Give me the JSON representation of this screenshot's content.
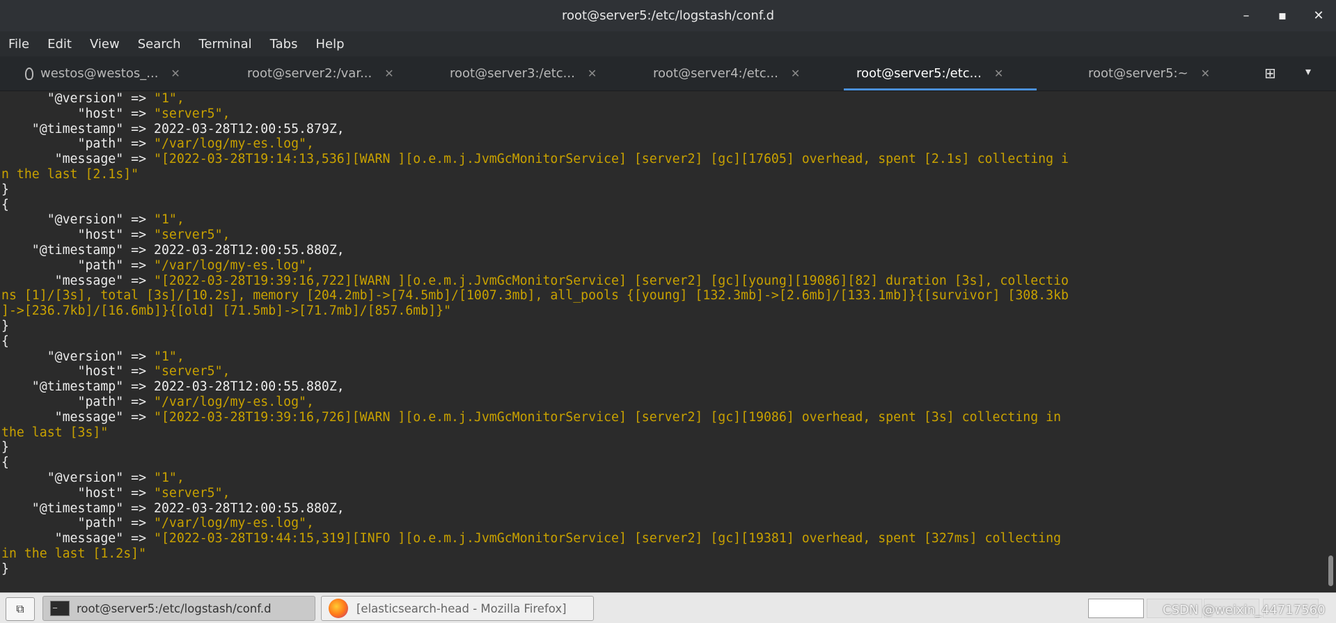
{
  "window": {
    "title": "root@server5:/etc/logstash/conf.d",
    "minimize": "–",
    "maximize": "▪",
    "close": "✕"
  },
  "menu": [
    "File",
    "Edit",
    "View",
    "Search",
    "Terminal",
    "Tabs",
    "Help"
  ],
  "tabs": [
    {
      "label": "westos@westos_...",
      "close": "✕"
    },
    {
      "label": "root@server2:/var...",
      "close": "✕"
    },
    {
      "label": "root@server3:/etc...",
      "close": "✕"
    },
    {
      "label": "root@server4:/etc...",
      "close": "✕"
    },
    {
      "label": "root@server5:/etc...",
      "close": "✕"
    },
    {
      "label": "root@server5:~",
      "close": "✕"
    }
  ],
  "tabbar": {
    "new_tab_icon": "⊞",
    "menu_icon": "▾"
  },
  "terminal": {
    "lines": [
      {
        "k": "      \"@version\" => ",
        "v": "\"1\","
      },
      {
        "k": "          \"host\" => ",
        "v": "\"server5\","
      },
      {
        "k": "    \"@timestamp\" => 2022-03-28T12:00:55.879Z,",
        "v": ""
      },
      {
        "k": "          \"path\" => ",
        "v": "\"/var/log/my-es.log\","
      },
      {
        "k": "       \"message\" => ",
        "v": "\"[2022-03-28T19:14:13,536][WARN ][o.e.m.j.JvmGcMonitorService] [server2] [gc][17605] overhead, spent [2.1s] collecting i"
      },
      {
        "k": "",
        "v": "n the last [2.1s]\""
      },
      {
        "k": "}",
        "v": ""
      },
      {
        "k": "{",
        "v": ""
      },
      {
        "k": "      \"@version\" => ",
        "v": "\"1\","
      },
      {
        "k": "          \"host\" => ",
        "v": "\"server5\","
      },
      {
        "k": "    \"@timestamp\" => 2022-03-28T12:00:55.880Z,",
        "v": ""
      },
      {
        "k": "          \"path\" => ",
        "v": "\"/var/log/my-es.log\","
      },
      {
        "k": "       \"message\" => ",
        "v": "\"[2022-03-28T19:39:16,722][WARN ][o.e.m.j.JvmGcMonitorService] [server2] [gc][young][19086][82] duration [3s], collectio"
      },
      {
        "k": "",
        "v": "ns [1]/[3s], total [3s]/[10.2s], memory [204.2mb]->[74.5mb]/[1007.3mb], all_pools {[young] [132.3mb]->[2.6mb]/[133.1mb]}{[survivor] [308.3kb"
      },
      {
        "k": "",
        "v": "]->[236.7kb]/[16.6mb]}{[old] [71.5mb]->[71.7mb]/[857.6mb]}\""
      },
      {
        "k": "}",
        "v": ""
      },
      {
        "k": "{",
        "v": ""
      },
      {
        "k": "      \"@version\" => ",
        "v": "\"1\","
      },
      {
        "k": "          \"host\" => ",
        "v": "\"server5\","
      },
      {
        "k": "    \"@timestamp\" => 2022-03-28T12:00:55.880Z,",
        "v": ""
      },
      {
        "k": "          \"path\" => ",
        "v": "\"/var/log/my-es.log\","
      },
      {
        "k": "       \"message\" => ",
        "v": "\"[2022-03-28T19:39:16,726][WARN ][o.e.m.j.JvmGcMonitorService] [server2] [gc][19086] overhead, spent [3s] collecting in"
      },
      {
        "k": "",
        "v": "the last [3s]\""
      },
      {
        "k": "}",
        "v": ""
      },
      {
        "k": "{",
        "v": ""
      },
      {
        "k": "      \"@version\" => ",
        "v": "\"1\","
      },
      {
        "k": "          \"host\" => ",
        "v": "\"server5\","
      },
      {
        "k": "    \"@timestamp\" => 2022-03-28T12:00:55.880Z,",
        "v": ""
      },
      {
        "k": "          \"path\" => ",
        "v": "\"/var/log/my-es.log\","
      },
      {
        "k": "       \"message\" => ",
        "v": "\"[2022-03-28T19:44:15,319][INFO ][o.e.m.j.JvmGcMonitorService] [server2] [gc][19381] overhead, spent [327ms] collecting"
      },
      {
        "k": "",
        "v": "in the last [1.2s]\""
      },
      {
        "k": "}",
        "v": ""
      }
    ]
  },
  "taskbar": {
    "show_desktop_icon": "⧉",
    "tasks": [
      {
        "label": "root@server5:/etc/logstash/conf.d"
      },
      {
        "label": "[elasticsearch-head - Mozilla Firefox]"
      }
    ],
    "watermark": "CSDN @weixin_44717560"
  },
  "colors": {
    "string_yellow": "#c8a100",
    "terminal_bg": "#2b2b2b",
    "tab_underline": "#4a90d9"
  }
}
